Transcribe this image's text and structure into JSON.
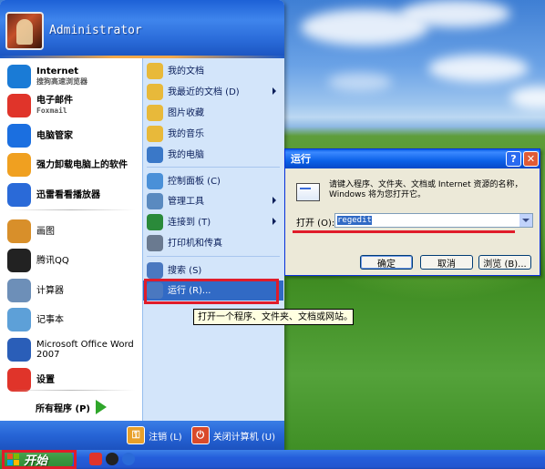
{
  "user": {
    "name": "Administrator"
  },
  "left_items": [
    {
      "label": "Internet",
      "sub": "搜狗高速浏览器",
      "icon": "sogou-browser-icon",
      "color": "#1a7bd6"
    },
    {
      "label": "电子邮件",
      "sub": "Foxmail",
      "icon": "foxmail-icon",
      "color": "#e0342a"
    },
    {
      "label": "电脑管家",
      "sub": "",
      "icon": "pc-manager-shield-icon",
      "color": "#1b6fe0"
    },
    {
      "label": "强力卸载电脑上的软件",
      "sub": "",
      "icon": "uninstall-flower-icon",
      "color": "#f0a020"
    },
    {
      "label": "迅雷看看播放器",
      "sub": "",
      "icon": "xunlei-player-icon",
      "color": "#2a6ad8"
    },
    {
      "label": "画图",
      "sub": "",
      "icon": "paint-icon",
      "color": "#d88f2a"
    },
    {
      "label": "腾讯QQ",
      "sub": "",
      "icon": "qq-penguin-icon",
      "color": "#222222"
    },
    {
      "label": "计算器",
      "sub": "",
      "icon": "calculator-icon",
      "color": "#6d8fb8"
    },
    {
      "label": "记事本",
      "sub": "",
      "icon": "notepad-icon",
      "color": "#5da0d8"
    },
    {
      "label": "Microsoft Office Word 2007",
      "sub": "",
      "icon": "word-icon",
      "color": "#2a5eb8"
    },
    {
      "label": "设置",
      "sub": "",
      "icon": "settings-s-icon",
      "color": "#e0342a"
    }
  ],
  "all_programs": "所有程序 (P)",
  "right_items": [
    {
      "label": "我的文档",
      "icon": "my-documents-icon",
      "color": "#e8b93a",
      "arrow": false
    },
    {
      "label": "我最近的文档 (D)",
      "icon": "recent-documents-icon",
      "color": "#e8b93a",
      "arrow": true
    },
    {
      "label": "图片收藏",
      "icon": "my-pictures-icon",
      "color": "#e8b93a",
      "arrow": false
    },
    {
      "label": "我的音乐",
      "icon": "my-music-icon",
      "color": "#e8b93a",
      "arrow": false
    },
    {
      "label": "我的电脑",
      "icon": "my-computer-icon",
      "color": "#3a78c8",
      "arrow": false
    },
    {
      "label": "控制面板 (C)",
      "icon": "control-panel-icon",
      "color": "#4a90d8",
      "arrow": false
    },
    {
      "label": "管理工具",
      "icon": "admin-tools-icon",
      "color": "#5a8ac0",
      "arrow": true
    },
    {
      "label": "连接到 (T)",
      "icon": "connect-to-icon",
      "color": "#2a8a3a",
      "arrow": true
    },
    {
      "label": "打印机和传真",
      "icon": "printer-icon",
      "color": "#6a7a90",
      "arrow": false
    },
    {
      "label": "搜索 (S)",
      "icon": "search-icon",
      "color": "#4a78c0",
      "arrow": false
    },
    {
      "label": "运行 (R)...",
      "icon": "run-icon",
      "color": "#4a78c0",
      "arrow": false
    }
  ],
  "footer": {
    "logoff": "注销 (L)",
    "shutdown": "关闭计算机 (U)"
  },
  "taskbar": {
    "start_label": "开始"
  },
  "tooltip": "打开一个程序、文件夹、文档或网站。",
  "run_dialog": {
    "title": "运行",
    "description": "请键入程序、文件夹、文档或 Internet 资源的名称，Windows 将为您打开它。",
    "open_label": "打开 (O):",
    "open_value": "regedit",
    "ok": "确定",
    "cancel": "取消",
    "browse": "浏览 (B)..."
  }
}
